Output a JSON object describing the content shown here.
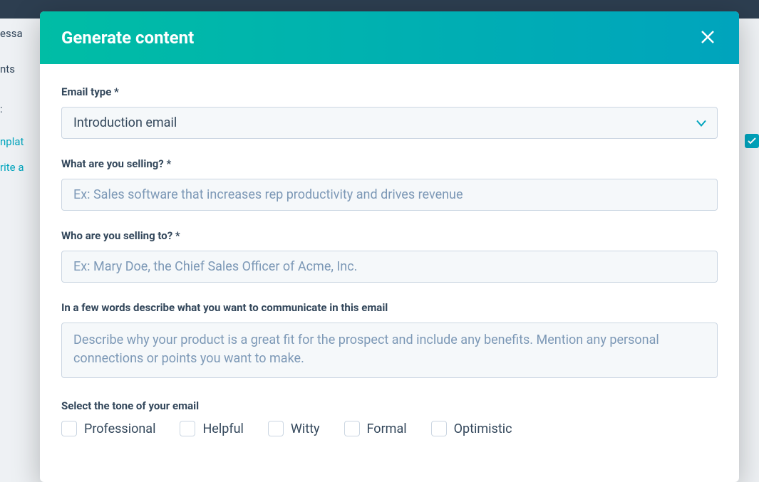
{
  "background": {
    "text1": "essa",
    "text2": "nts",
    "text3": ":",
    "link1": "nplat",
    "link2": "rite a"
  },
  "modal": {
    "title": "Generate content",
    "close_aria": "Close"
  },
  "form": {
    "email_type": {
      "label": "Email type *",
      "value": "Introduction email"
    },
    "selling_what": {
      "label": "What are you selling? *",
      "placeholder": "Ex: Sales software that increases rep productivity and drives revenue"
    },
    "selling_to": {
      "label": "Who are you selling to? *",
      "placeholder": "Ex: Mary Doe, the Chief Sales Officer of Acme, Inc."
    },
    "describe": {
      "label": "In a few words describe what you want to communicate in this email",
      "placeholder": "Describe why your product is a great fit for the prospect and include any benefits. Mention any personal connections or points you want to make."
    },
    "tone": {
      "label": "Select the tone of your email",
      "options": [
        "Professional",
        "Helpful",
        "Witty",
        "Formal",
        "Optimistic"
      ]
    }
  }
}
